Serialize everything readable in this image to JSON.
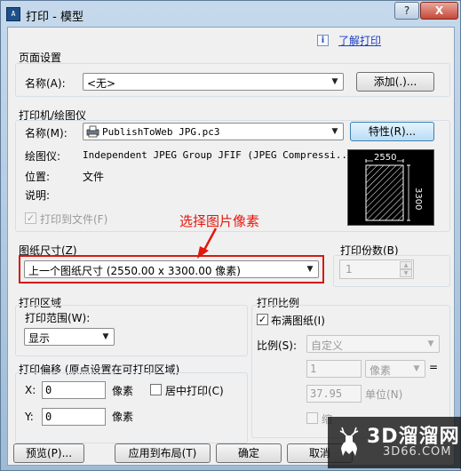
{
  "window": {
    "title": "打印 - 模型",
    "help_button": "?",
    "close_button": "X",
    "app_icon": "autocad-icon"
  },
  "help_link": "了解打印",
  "page_setup": {
    "group_title": "页面设置",
    "name_label": "名称(A):",
    "name_value": "<无>",
    "add_button": "添加(.)..."
  },
  "printer": {
    "group_title": "打印机/绘图仪",
    "name_label": "名称(M):",
    "name_value": "PublishToWeb JPG.pc3",
    "properties_button": "特性(R)...",
    "plotter_label": "绘图仪:",
    "plotter_value": "Independent JPEG Group JFIF (JPEG Compressi...",
    "location_label": "位置:",
    "location_value": "文件",
    "description_label": "说明:",
    "print_to_file_label": "打印到文件(F)",
    "print_to_file_checked": true,
    "preview_width": "2550",
    "preview_height": "3300"
  },
  "annotation": {
    "text": "选择图片像素",
    "color": "#e3170d"
  },
  "paper_size": {
    "group_title": "图纸尺寸(Z)",
    "value": "上一个图纸尺寸   (2550.00 x 3300.00 像素)"
  },
  "copies": {
    "group_title": "打印份数(B)",
    "value": "1"
  },
  "plot_area": {
    "group_title": "打印区域",
    "range_label": "打印范围(W):",
    "range_value": "显示"
  },
  "plot_scale": {
    "group_title": "打印比例",
    "fit_label": "布满图纸(I)",
    "fit_checked": true,
    "scale_label": "比例(S):",
    "scale_value": "自定义",
    "value1": "1",
    "unit1": "像素",
    "equals": "=",
    "value2": "37.95",
    "unit2": "单位(N)",
    "scale_lineweights_label": "缩"
  },
  "plot_offset": {
    "group_title": "打印偏移 (原点设置在可打印区域)",
    "x_label": "X:",
    "x_value": "0",
    "x_unit": "像素",
    "center_label": "居中打印(C)",
    "center_checked": false,
    "y_label": "Y:",
    "y_value": "0",
    "y_unit": "像素"
  },
  "buttons": {
    "preview": "预览(P)...",
    "apply_to_layout": "应用到布局(T)",
    "ok": "确定",
    "cancel": "取消"
  },
  "watermark": {
    "main": "3D溜溜网",
    "sub": "3D66.COM"
  }
}
